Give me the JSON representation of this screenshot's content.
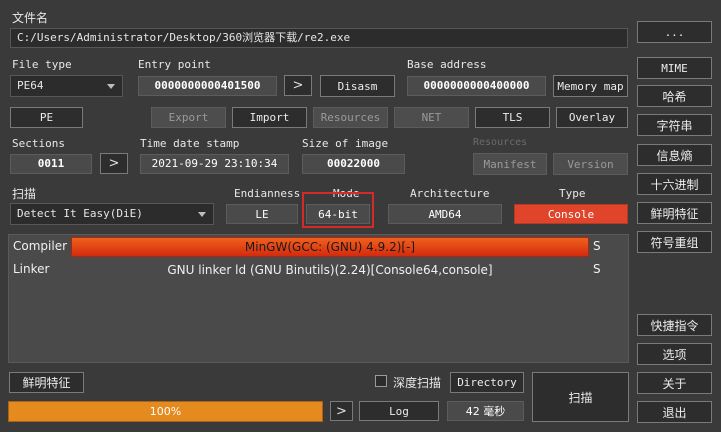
{
  "file": {
    "label": "文件名",
    "path": "C:/Users/Administrator/Desktop/360浏览器下载/re2.exe",
    "browse_label": "..."
  },
  "file_type": {
    "label": "File type",
    "value": "PE64"
  },
  "entry_point": {
    "label": "Entry point",
    "value": "0000000000401500",
    "go_label": ">",
    "disasm_label": "Disasm"
  },
  "base_address": {
    "label": "Base address",
    "value": "0000000000400000",
    "memory_map_label": "Memory map"
  },
  "toolbar_row": {
    "pe": "PE",
    "export": "Export",
    "import": "Import",
    "resources": "Resources",
    "net": "NET",
    "tls": "TLS",
    "overlay": "Overlay"
  },
  "sections": {
    "label": "Sections",
    "value": "0011",
    "go_label": ">"
  },
  "time_date_stamp": {
    "label": "Time date stamp",
    "value": "2021-09-29 23:10:34"
  },
  "size_of_image": {
    "label": "Size of image",
    "value": "00022000"
  },
  "resources_group": {
    "label": "Resources",
    "manifest": "Manifest",
    "version": "Version"
  },
  "scan": {
    "label": "扫描",
    "engine": "Detect It Easy(DiE)"
  },
  "endianness": {
    "label": "Endianness",
    "value": "LE"
  },
  "mode": {
    "label": "Mode",
    "value": "64-bit"
  },
  "architecture": {
    "label": "Architecture",
    "value": "AMD64"
  },
  "type": {
    "label": "Type",
    "value": "Console"
  },
  "results": [
    {
      "type": "Compiler",
      "info": "MinGW(GCC: (GNU) 4.9.2)[-]",
      "flag": "S"
    },
    {
      "type": "Linker",
      "info": "GNU linker ld (GNU Binutils)(2.24)[Console64,console]",
      "flag": "S"
    }
  ],
  "bottom": {
    "signatures_label": "鲜明特征",
    "deep_scan_label": "深度扫描",
    "directory_label": "Directory",
    "scan_button": "扫描",
    "progress_text": "100%",
    "progress_fraction": 1.0,
    "go_label": ">",
    "log_label": "Log",
    "elapsed": "42 毫秒"
  },
  "sidebar": {
    "mime": "MIME",
    "hash": "哈希",
    "strings": "字符串",
    "entropy": "信息熵",
    "hex": "十六进制",
    "signatures": "鲜明特征",
    "symbols": "符号重组",
    "shortcuts": "快捷指令",
    "options": "选项",
    "about": "关于",
    "exit": "退出"
  },
  "colors": {
    "background": "#3a3a3a",
    "console": "#e0442a",
    "compiler_highlight": "#e0461a",
    "progress": "#e58a1f",
    "annotation_box": "#d42a2a"
  }
}
